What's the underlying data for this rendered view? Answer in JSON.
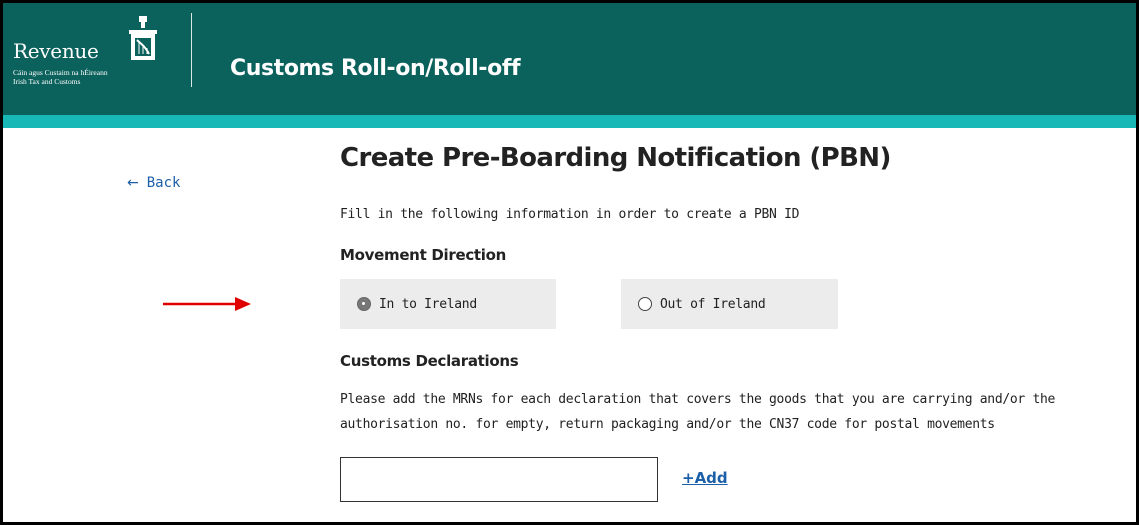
{
  "header": {
    "logo": {
      "word": "Revenue",
      "subtitle_irish": "Cáin agus Custaim na hÉireann",
      "subtitle_english": "Irish Tax and Customs"
    },
    "app_title": "Customs Roll-on/Roll-off",
    "background_color": "#0b615c",
    "stripe_color": "#18b8b6"
  },
  "nav": {
    "back_label": "Back",
    "back_icon": "arrow-left-icon"
  },
  "main": {
    "title": "Create Pre-Boarding Notification (PBN)",
    "intro": "Fill in the following information in order to create a PBN ID",
    "movement_direction": {
      "label": "Movement Direction",
      "options": [
        {
          "label": "In to Ireland",
          "selected": true
        },
        {
          "label": "Out of Ireland",
          "selected": false
        }
      ]
    },
    "customs_declarations": {
      "label": "Customs Declarations",
      "help": "Please add the MRNs for each declaration that covers the goods that you are carrying and/or the authorisation no. for empty, return packaging and/or the CN37 code for postal movements",
      "input_value": "",
      "add_label": "+Add"
    }
  },
  "annotation": {
    "icon": "red-arrow-icon",
    "color": "#e00000"
  }
}
